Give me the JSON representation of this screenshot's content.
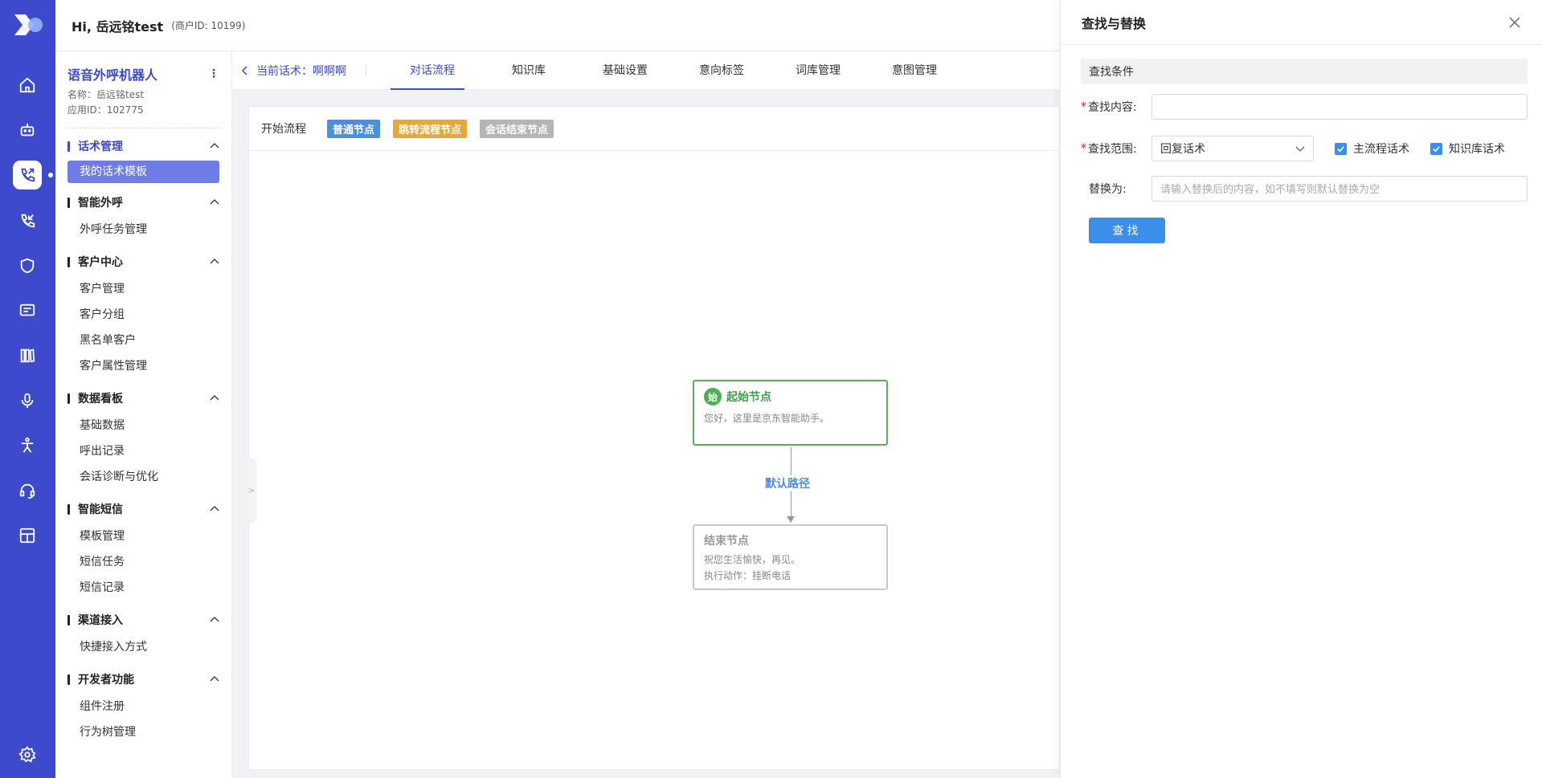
{
  "header": {
    "greeting": "Hi, 岳远铭test",
    "merchant_id": "(商户ID: 10199)"
  },
  "rail": {
    "icons": [
      "logo-icon",
      "home-icon",
      "robot-icon",
      "phone-call-icon",
      "phone-incoming-icon",
      "shield-icon",
      "message-icon",
      "library-icon",
      "microphone-icon",
      "person-icon",
      "headset-icon",
      "dashboard-icon",
      "settings-icon"
    ],
    "active": "phone-call-icon"
  },
  "sidebar": {
    "app_name": "语音外呼机器人",
    "more_symbol": "⋮",
    "name_line": "名称：岳远铭test",
    "app_id_line": "应用ID：102775",
    "groups": [
      {
        "title": "话术管理",
        "active": true,
        "items": [
          "我的话术模板"
        ]
      },
      {
        "title": "智能外呼",
        "items": [
          "外呼任务管理"
        ]
      },
      {
        "title": "客户中心",
        "items": [
          "客户管理",
          "客户分组",
          "黑名单客户",
          "客户属性管理"
        ]
      },
      {
        "title": "数据看板",
        "items": [
          "基础数据",
          "呼出记录",
          "会话诊断与优化"
        ]
      },
      {
        "title": "智能短信",
        "items": [
          "模板管理",
          "短信任务",
          "短信记录"
        ]
      },
      {
        "title": "渠道接入",
        "items": [
          "快捷接入方式"
        ]
      },
      {
        "title": "开发者功能",
        "items": [
          "组件注册",
          "行为树管理"
        ]
      }
    ]
  },
  "tabs": {
    "back_label": "当前话术：啊啊啊",
    "items": [
      "对话流程",
      "知识库",
      "基础设置",
      "意向标签",
      "词库管理",
      "意图管理"
    ],
    "active": "对话流程"
  },
  "canvas": {
    "start_label": "开始流程",
    "legend": [
      {
        "label": "普通节点",
        "color": "#4a90e2"
      },
      {
        "label": "跳转流程节点",
        "color": "#e5a93a"
      },
      {
        "label": "会话结束节点",
        "color": "#b5b5b5"
      }
    ],
    "collapse_symbol": ">",
    "start_node": {
      "badge": "始",
      "title": "起始节点",
      "text": "您好，这里是京东智能助手。"
    },
    "edge_label": "默认路径",
    "end_node": {
      "title": "结束节点",
      "text1": "祝您生活愉快，再见。",
      "text2": "执行动作：挂断电话"
    }
  },
  "drawer": {
    "title": "查找与替换",
    "section": "查找条件",
    "find_label": "查找内容:",
    "find_value": "",
    "scope_label": "查找范围:",
    "scope_value": "回复话术",
    "check_main": "主流程话术",
    "check_kb": "知识库话术",
    "replace_label": "替换为:",
    "replace_placeholder": "请输入替换后的内容，如不填写则默认替换为空",
    "search_button": "查找"
  }
}
